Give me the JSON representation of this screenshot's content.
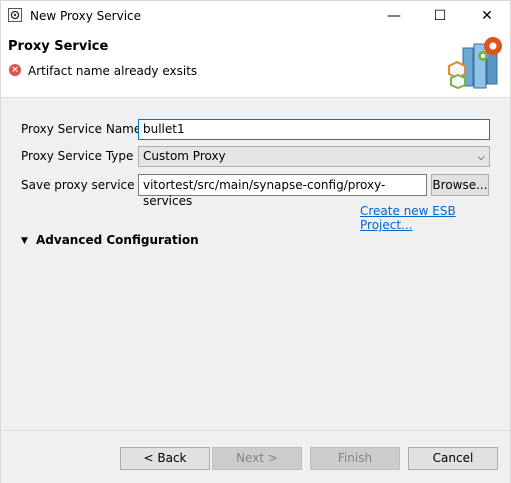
{
  "window": {
    "title": "New Proxy Service",
    "minimize_glyph": "—",
    "maximize_glyph": "☐",
    "close_glyph": "✕"
  },
  "header": {
    "title": "Proxy Service",
    "error_glyph": "×",
    "error_message": "Artifact name already exsits"
  },
  "form": {
    "name_label": "Proxy Service Name",
    "name_value": "bullet1",
    "type_label": "Proxy Service Type",
    "type_value": "Custom Proxy",
    "save_label": "Save proxy service in:",
    "save_path": "vitortest/src/main/synapse-config/proxy-services",
    "browse_label": "Browse...",
    "create_project_link": "Create new ESB Project...",
    "advanced_label": "Advanced Configuration",
    "dropdown_arrow": "⌵",
    "advanced_arrow": "▼"
  },
  "footer": {
    "back_label": "< Back",
    "next_label": "Next >",
    "finish_label": "Finish",
    "cancel_label": "Cancel"
  },
  "icons": {
    "app": "gear-window-icon",
    "error": "error-circle-icon",
    "wizard": "esb-wizard-graphic-icon"
  }
}
